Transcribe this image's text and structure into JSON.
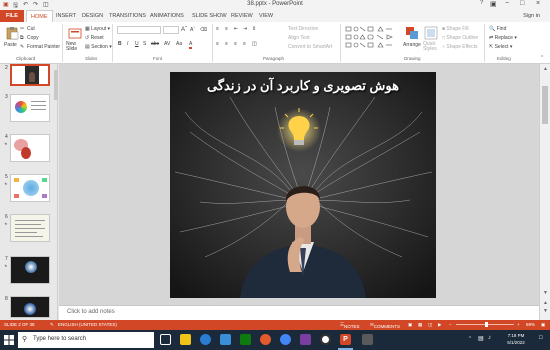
{
  "window": {
    "title": "38.pptx - PowerPoint",
    "help": "?",
    "controls": [
      "−",
      "□",
      "×"
    ]
  },
  "tabs": {
    "file": "FILE",
    "items": [
      "HOME",
      "INSERT",
      "DESIGN",
      "TRANSITIONS",
      "ANIMATIONS",
      "SLIDE SHOW",
      "REVIEW",
      "VIEW"
    ],
    "signin": "Sign in"
  },
  "ribbon": {
    "clipboard": {
      "paste": "Paste",
      "cut": "Cut",
      "copy": "Copy",
      "format_painter": "Format Painter",
      "label": "Clipboard"
    },
    "slides": {
      "new_slide": "New Slide",
      "layout": "Layout",
      "reset": "Reset",
      "section": "Section",
      "label": "Slides"
    },
    "font": {
      "label": "Font",
      "buttons": [
        "B",
        "I",
        "U",
        "S",
        "abc",
        "AV",
        "Aa",
        "A"
      ]
    },
    "paragraph": {
      "label": "Paragraph",
      "text_direction": "Text Direction",
      "align_text": "Align Text",
      "convert": "Convert to SmartArt"
    },
    "drawing": {
      "label": "Drawing",
      "arrange": "Arrange",
      "quick_styles": "Quick Styles",
      "shape_fill": "Shape Fill",
      "shape_outline": "Shape Outline",
      "shape_effects": "Shape Effects"
    },
    "editing": {
      "label": "Editing",
      "find": "Find",
      "replace": "Replace",
      "select": "Select"
    }
  },
  "thumbnails": [
    {
      "num": "2",
      "selected": true
    },
    {
      "num": "3",
      "selected": false
    },
    {
      "num": "4",
      "selected": false
    },
    {
      "num": "5",
      "selected": false
    },
    {
      "num": "6",
      "selected": false
    },
    {
      "num": "7",
      "selected": false
    },
    {
      "num": "8",
      "selected": false
    }
  ],
  "slide": {
    "title": "هوش تصویری و کاربرد آن در زندگی"
  },
  "notes": {
    "placeholder": "Click to add notes"
  },
  "status": {
    "slide": "SLIDE 2 OF 38",
    "language": "ENGLISH (UNITED STATES)",
    "notes": "NOTES",
    "comments": "COMMENTS",
    "zoom": "69%"
  },
  "taskbar": {
    "search_placeholder": "Type here to search",
    "time": "7:18 PM",
    "date": "5/1/2022"
  },
  "colors": {
    "accent": "#d24726",
    "taskbar": "#1b2a3a"
  }
}
